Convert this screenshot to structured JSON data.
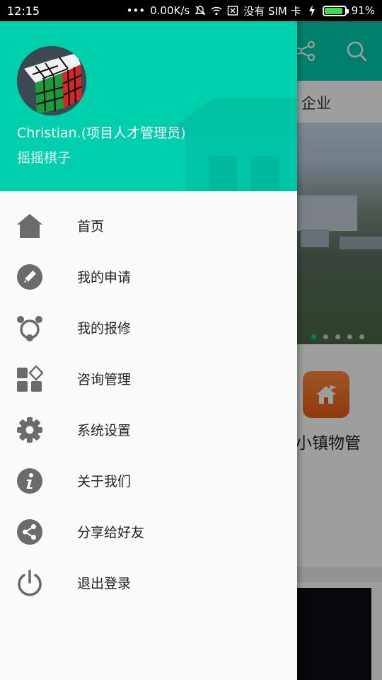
{
  "status_bar": {
    "time": "12:15",
    "dots": "•••",
    "speed": "0.00K/s",
    "sim_text": "没有 SIM 卡",
    "battery": "91%",
    "battery_level": 0.91,
    "battery_color": "#3ddc52"
  },
  "background": {
    "tab_label": "企业",
    "town_label": "小镇物管",
    "accent": "#00cfae",
    "share_icon": "share-icon",
    "search_icon": "search-icon"
  },
  "drawer": {
    "header": {
      "user_name": "Christian.(项目人才管理员)",
      "subtitle": "摇摇棋子",
      "avatar_icon": "rubiks-cube-avatar"
    },
    "items": [
      {
        "label": "首页",
        "icon": "home-icon"
      },
      {
        "label": "我的申请",
        "icon": "pencil-icon"
      },
      {
        "label": "我的报修",
        "icon": "repair-icon"
      },
      {
        "label": "咨询管理",
        "icon": "apps-icon"
      },
      {
        "label": "系统设置",
        "icon": "gear-icon"
      },
      {
        "label": "关于我们",
        "icon": "info-icon"
      },
      {
        "label": "分享给好友",
        "icon": "share-icon"
      },
      {
        "label": "退出登录",
        "icon": "power-icon"
      }
    ],
    "icon_color": "#6b6b6b"
  }
}
